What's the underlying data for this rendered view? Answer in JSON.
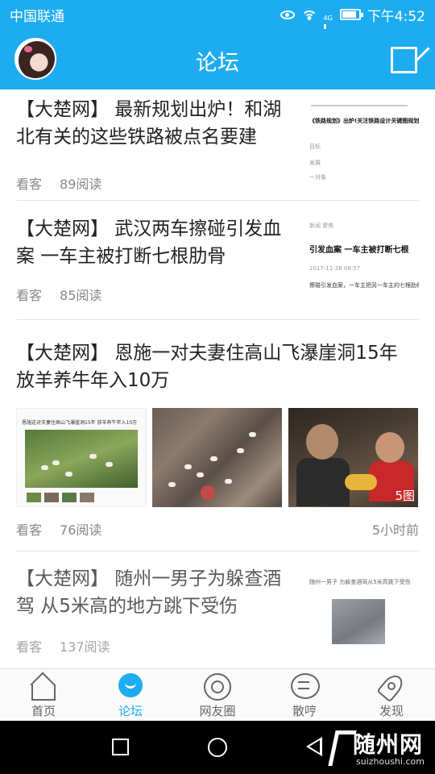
{
  "status_bar": {
    "carrier": "中国联通",
    "network": "4G",
    "time": "下午4:52"
  },
  "header": {
    "title": "论坛"
  },
  "posts": [
    {
      "headline": "【大楚网】 最新规划出炉！和湖北有关的这些铁路被点名要建",
      "author": "看客",
      "reads": "89阅读",
      "thumb": {
        "line1": "《铁路规划》出炉!关注铁路设计关键图规划",
        "line2": "目标",
        "line3": "发展",
        "line4": "一对象"
      }
    },
    {
      "headline": "【大楚网】 武汉两车擦碰引发血案 一车主被打断七根肋骨",
      "author": "看客",
      "reads": "85阅读",
      "thumb": {
        "line1": "新闻  聚焦",
        "line2": "引发血案 一车主被打断七根",
        "line3": "2017-11-26 08:57",
        "line4": "擦碰引发血案，一车主把另一车主的七根肋骨"
      }
    },
    {
      "headline": "【大楚网】 恩施一对夫妻住高山飞瀑崖洞15年 放羊养牛年入10万",
      "author": "看客",
      "reads": "76阅读",
      "time": "5小时前",
      "image_count": "5图",
      "thumb": {
        "line1": "恩施这对夫妻住高山飞瀑崖洞15年 放羊养牛年入10万"
      }
    },
    {
      "headline": "【大楚网】 随州一男子为躲查酒驾 从5米高的地方跳下受伤",
      "author": "看客",
      "reads": "137阅读",
      "thumb": {
        "line1": "随州一男子 为躲查酒驾从5米高跳下受伤"
      }
    }
  ],
  "tabs": [
    {
      "label": "首页",
      "icon": "home-icon"
    },
    {
      "label": "论坛",
      "icon": "forum-icon"
    },
    {
      "label": "网友圈",
      "icon": "friends-circle-icon"
    },
    {
      "label": "散哼",
      "icon": "chat-icon"
    },
    {
      "label": "发现",
      "icon": "rocket-icon"
    }
  ],
  "watermark": {
    "name": "随州网",
    "domain": "suizhoushi.com"
  },
  "colors": {
    "accent": "#1dacf0"
  }
}
